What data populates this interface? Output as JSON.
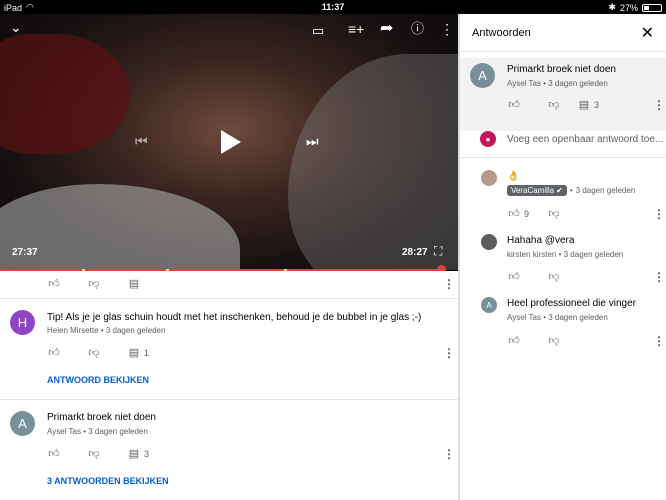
{
  "status": {
    "device": "iPad",
    "time": "11:37",
    "battery": "27%"
  },
  "video": {
    "time_current": "27:37",
    "time_total": "28:27",
    "progress": 0.955
  },
  "comments": [
    {
      "avatar_letter": "H",
      "text": "Tip! Als je je glas schuin houdt met het inschenken, behoud je de bubbel in je glas ;-)",
      "author": "Helen Mirsette",
      "time": "3 dagen geleden",
      "reply_count": "1",
      "link": "ANTWOORD BEKIJKEN"
    },
    {
      "avatar_letter": "A",
      "text": "Primarkt broek niet doen",
      "author": "Aysel Tas",
      "time": "3 dagen geleden",
      "reply_count": "3",
      "link": "3 ANTWOORDEN BEKIJKEN"
    }
  ],
  "replies_panel": {
    "title": "Antwoorden",
    "parent": {
      "avatar_letter": "A",
      "text": "Primarkt broek niet doen",
      "author": "Aysel Tas",
      "time": "3 dagen geleden",
      "reply_count": "3"
    },
    "reply_placeholder": "Voeg een openbaar antwoord toe...",
    "replies": [
      {
        "text": "👌",
        "author": "VeraCamilla",
        "time": "3 dagen geleden",
        "likes": "9"
      },
      {
        "text": "Hahaha @vera",
        "author": "kirsten kirsten",
        "time": "3 dagen geleden",
        "likes": ""
      },
      {
        "text": "Heel professioneel die vinger",
        "author": "Aysel Tas",
        "time": "3 dagen geleden",
        "likes": ""
      }
    ]
  },
  "colors": {
    "accent_red": "#e0413e",
    "link_blue": "#065fd4",
    "avatar_h": "#8e44c4",
    "avatar_a": "#78909c"
  }
}
